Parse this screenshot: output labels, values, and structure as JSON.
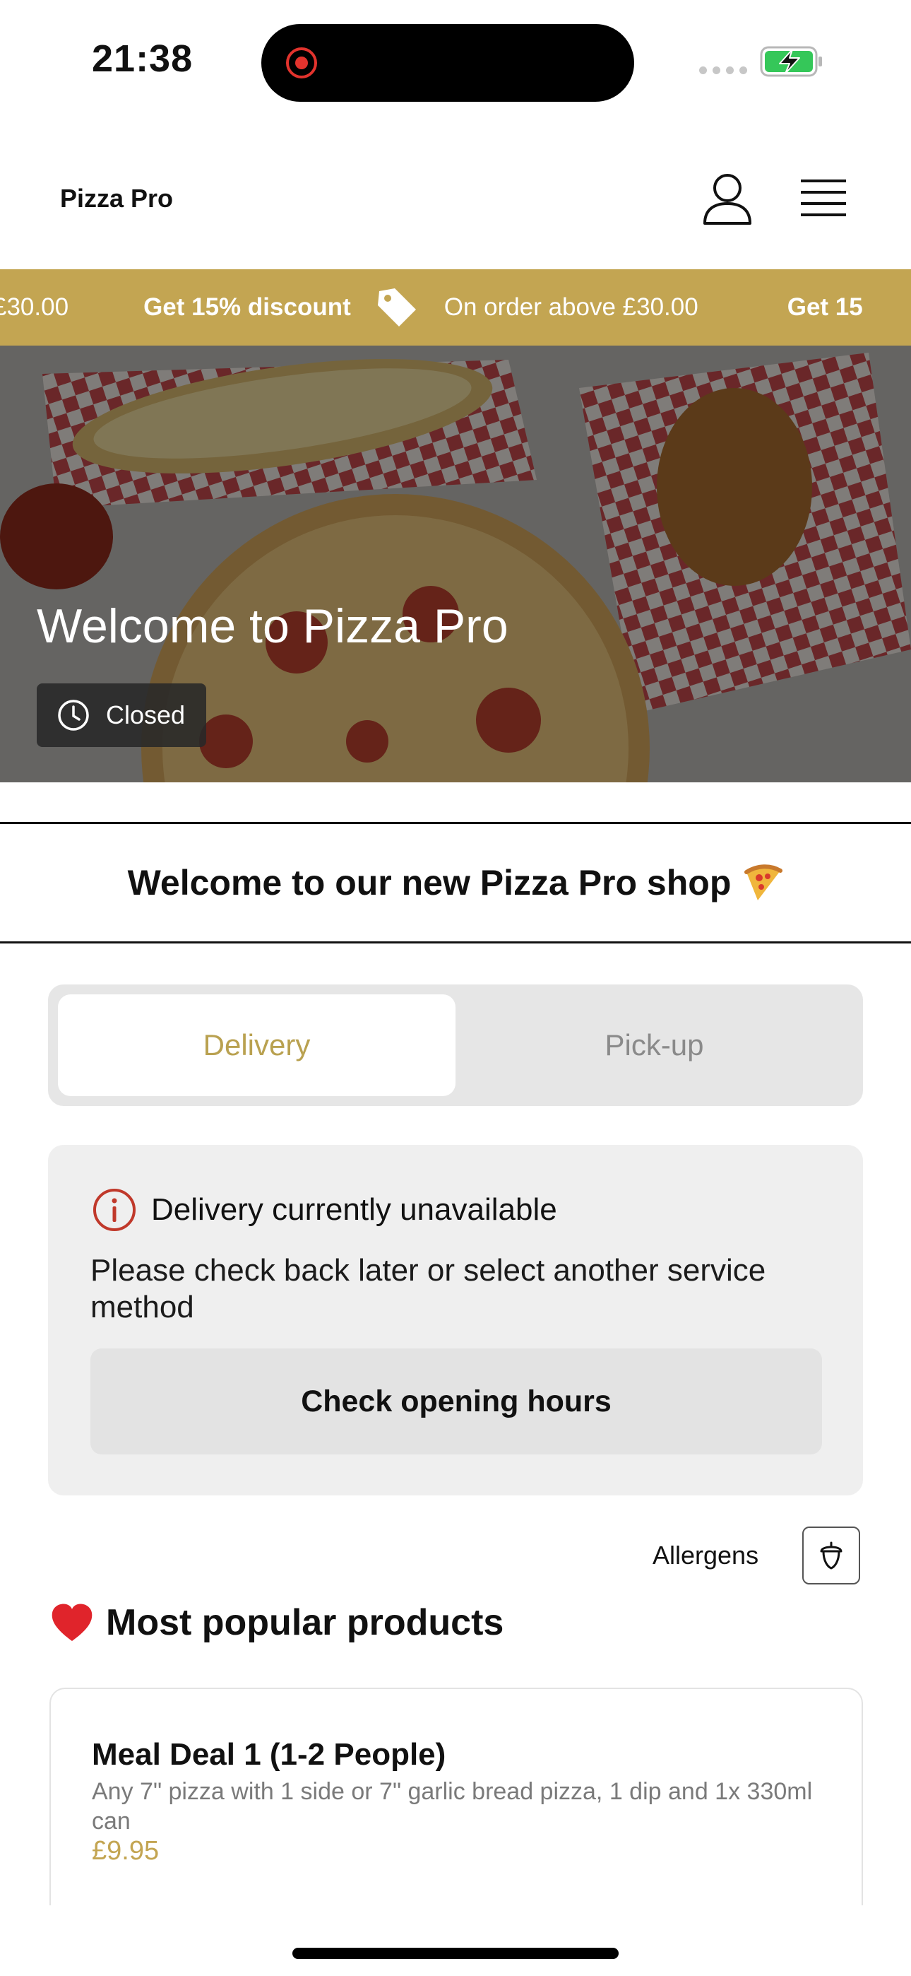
{
  "status_bar": {
    "time": "21:38"
  },
  "header": {
    "brand": "Pizza Pro",
    "icons": [
      "user-icon",
      "menu-icon"
    ]
  },
  "promo": {
    "left_fragment": "£30.00",
    "items": [
      {
        "bold": "Get 15% discount",
        "normal": "On order above £30.00"
      }
    ],
    "right_fragment": "Get 15",
    "background": "#c3a552",
    "icon": "tag-icon"
  },
  "hero": {
    "title": "Welcome to Pizza Pro",
    "status": "Closed",
    "status_icon": "clock-icon"
  },
  "welcome_strip": {
    "text": "Welcome to our new Pizza Pro shop",
    "icon": "pizza-icon"
  },
  "service": {
    "options": [
      "Delivery",
      "Pick-up"
    ],
    "selected": "Delivery",
    "accent": "#b9a150"
  },
  "alert": {
    "title": "Delivery currently unavailable",
    "message": "Please check back later or select another service method",
    "button": "Check opening hours",
    "icon": "info-icon",
    "icon_color": "#c0392b"
  },
  "allergens": {
    "label": "Allergens",
    "icon": "acorn-icon"
  },
  "popular": {
    "title": "Most popular products",
    "icon": "heart-icon",
    "products": [
      {
        "name": "Meal Deal 1 (1-2 People)",
        "description": "Any 7\" pizza with 1 side or 7\" garlic bread pizza, 1 dip and 1x 330ml can",
        "price": "£9.95"
      }
    ]
  }
}
